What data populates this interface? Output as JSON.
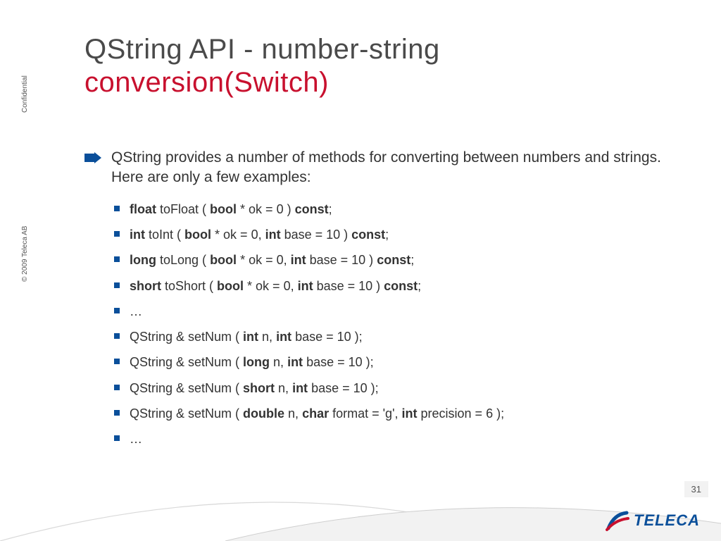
{
  "title": {
    "line1": "QString API - number-string",
    "line2": "conversion(Switch)"
  },
  "intro": "QString provides a number of methods for converting between numbers and strings. Here are only a few examples:",
  "items": [
    {
      "segments": [
        {
          "t": "float",
          "b": true
        },
        {
          "t": " toFloat ( "
        },
        {
          "t": "bool",
          "b": true
        },
        {
          "t": " * ok = 0 ) "
        },
        {
          "t": "const",
          "b": true
        },
        {
          "t": ";"
        }
      ]
    },
    {
      "segments": [
        {
          "t": "int",
          "b": true
        },
        {
          "t": " toInt ( "
        },
        {
          "t": "bool",
          "b": true
        },
        {
          "t": " * ok = 0, "
        },
        {
          "t": "int",
          "b": true
        },
        {
          "t": " base = 10 ) "
        },
        {
          "t": "const",
          "b": true
        },
        {
          "t": ";"
        }
      ]
    },
    {
      "segments": [
        {
          "t": "long",
          "b": true
        },
        {
          "t": " toLong ( "
        },
        {
          "t": "bool",
          "b": true
        },
        {
          "t": " * ok = 0, "
        },
        {
          "t": "int",
          "b": true
        },
        {
          "t": " base = 10 ) "
        },
        {
          "t": "const",
          "b": true
        },
        {
          "t": ";"
        }
      ]
    },
    {
      "segments": [
        {
          "t": "short",
          "b": true
        },
        {
          "t": " toShort ( "
        },
        {
          "t": "bool",
          "b": true
        },
        {
          "t": " * ok = 0, "
        },
        {
          "t": "int",
          "b": true
        },
        {
          "t": " base = 10 ) "
        },
        {
          "t": "const",
          "b": true
        },
        {
          "t": ";"
        }
      ]
    },
    {
      "segments": [
        {
          "t": "…"
        }
      ]
    },
    {
      "segments": [
        {
          "t": "QString & setNum ( "
        },
        {
          "t": "int",
          "b": true
        },
        {
          "t": " n, "
        },
        {
          "t": "int",
          "b": true
        },
        {
          "t": " base = 10 );"
        }
      ]
    },
    {
      "segments": [
        {
          "t": "QString & setNum ( "
        },
        {
          "t": "long",
          "b": true
        },
        {
          "t": " n, "
        },
        {
          "t": "int",
          "b": true
        },
        {
          "t": " base = 10 );"
        }
      ]
    },
    {
      "segments": [
        {
          "t": "QString & setNum ( "
        },
        {
          "t": "short",
          "b": true
        },
        {
          "t": " n, "
        },
        {
          "t": "int",
          "b": true
        },
        {
          "t": " base = 10 );"
        }
      ]
    },
    {
      "segments": [
        {
          "t": "QString & setNum ( "
        },
        {
          "t": "double",
          "b": true
        },
        {
          "t": " n, "
        },
        {
          "t": "char",
          "b": true
        },
        {
          "t": " format = 'g', "
        },
        {
          "t": "int",
          "b": true
        },
        {
          "t": " precision = 6 );"
        }
      ]
    },
    {
      "segments": [
        {
          "t": "…"
        }
      ]
    }
  ],
  "sidebar": {
    "confidential": "Confidential",
    "copyright": "© 2009 Teleca AB"
  },
  "page_number": "31",
  "logo": {
    "text": "TELECA"
  }
}
